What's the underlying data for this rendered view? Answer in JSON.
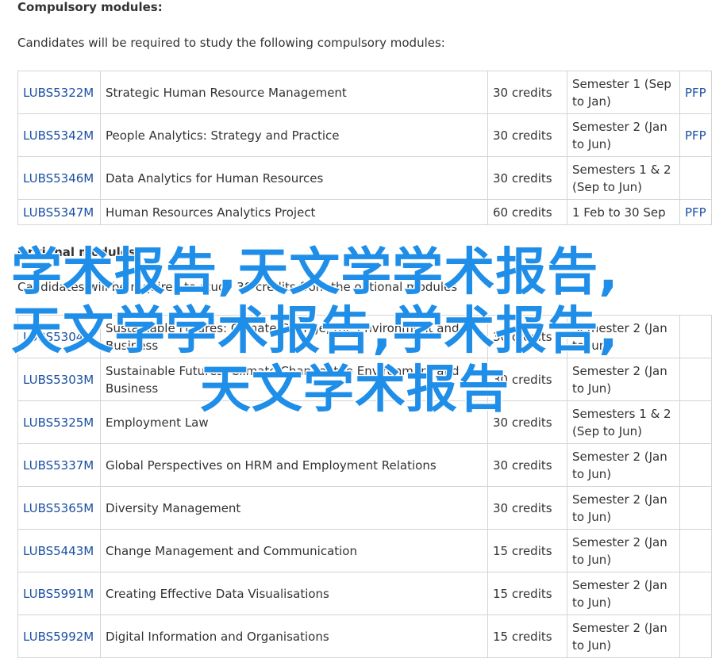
{
  "compulsory": {
    "heading": "Compulsory modules:",
    "intro": "Candidates will be required to study the following compulsory modules:",
    "rows": [
      {
        "code": "LUBS5322M",
        "title": "Strategic Human Resource Management",
        "credits": "30 credits",
        "semester": "Semester 1 (Sep to Jan)",
        "pfp": "PFP"
      },
      {
        "code": "LUBS5342M",
        "title": "People Analytics: Strategy and Practice",
        "credits": "30 credits",
        "semester": "Semester 2 (Jan to Jun)",
        "pfp": "PFP"
      },
      {
        "code": "LUBS5346M",
        "title": "Data Analytics for Human Resources",
        "credits": "30 credits",
        "semester": "Semesters 1 & 2 (Sep to Jun)",
        "pfp": ""
      },
      {
        "code": "LUBS5347M",
        "title": "Human Resources Analytics Project",
        "credits": "60 credits",
        "semester": "1 Feb to 30 Sep",
        "pfp": "PFP"
      }
    ]
  },
  "optional": {
    "heading": "Optional modules:",
    "intro": "Candidates will be required to study 30 credits from the optional modules",
    "rows": [
      {
        "code": "LUBS5304M",
        "title": "Sustainable Futures: Climate Change, the Environment and Business",
        "credits": "30 credits",
        "semester": "Semester 2 (Jan to Jun)",
        "pfp": ""
      },
      {
        "code": "LUBS5303M",
        "title": "Sustainable Futures: Climate Change, the Environment and Business",
        "credits": "30 credits",
        "semester": "Semester 2 (Jan to Jun)",
        "pfp": ""
      },
      {
        "code": "LUBS5325M",
        "title": "Employment Law",
        "credits": "30 credits",
        "semester": "Semesters 1 & 2 (Sep to Jun)",
        "pfp": ""
      },
      {
        "code": "LUBS5337M",
        "title": "Global Perspectives on HRM and Employment Relations",
        "credits": "30 credits",
        "semester": "Semester 2 (Jan to Jun)",
        "pfp": ""
      },
      {
        "code": "LUBS5365M",
        "title": "Diversity Management",
        "credits": "30 credits",
        "semester": "Semester 2 (Jan to Jun)",
        "pfp": ""
      },
      {
        "code": "LUBS5443M",
        "title": "Change Management and Communication",
        "credits": "15 credits",
        "semester": "Semester 2 (Jan to Jun)",
        "pfp": ""
      },
      {
        "code": "LUBS5991M",
        "title": "Creating Effective Data Visualisations",
        "credits": "15 credits",
        "semester": "Semester 2 (Jan to Jun)",
        "pfp": ""
      },
      {
        "code": "LUBS5992M",
        "title": "Digital Information and Organisations",
        "credits": "15 credits",
        "semester": "Semester 2 (Jan to Jun)",
        "pfp": ""
      }
    ]
  },
  "watermark": {
    "line1": "学术报告,天文学学术报告,",
    "line2": "天文学学术报告,学术报告,",
    "line3": "天文学术报告",
    "color": "#1f8ee8"
  }
}
